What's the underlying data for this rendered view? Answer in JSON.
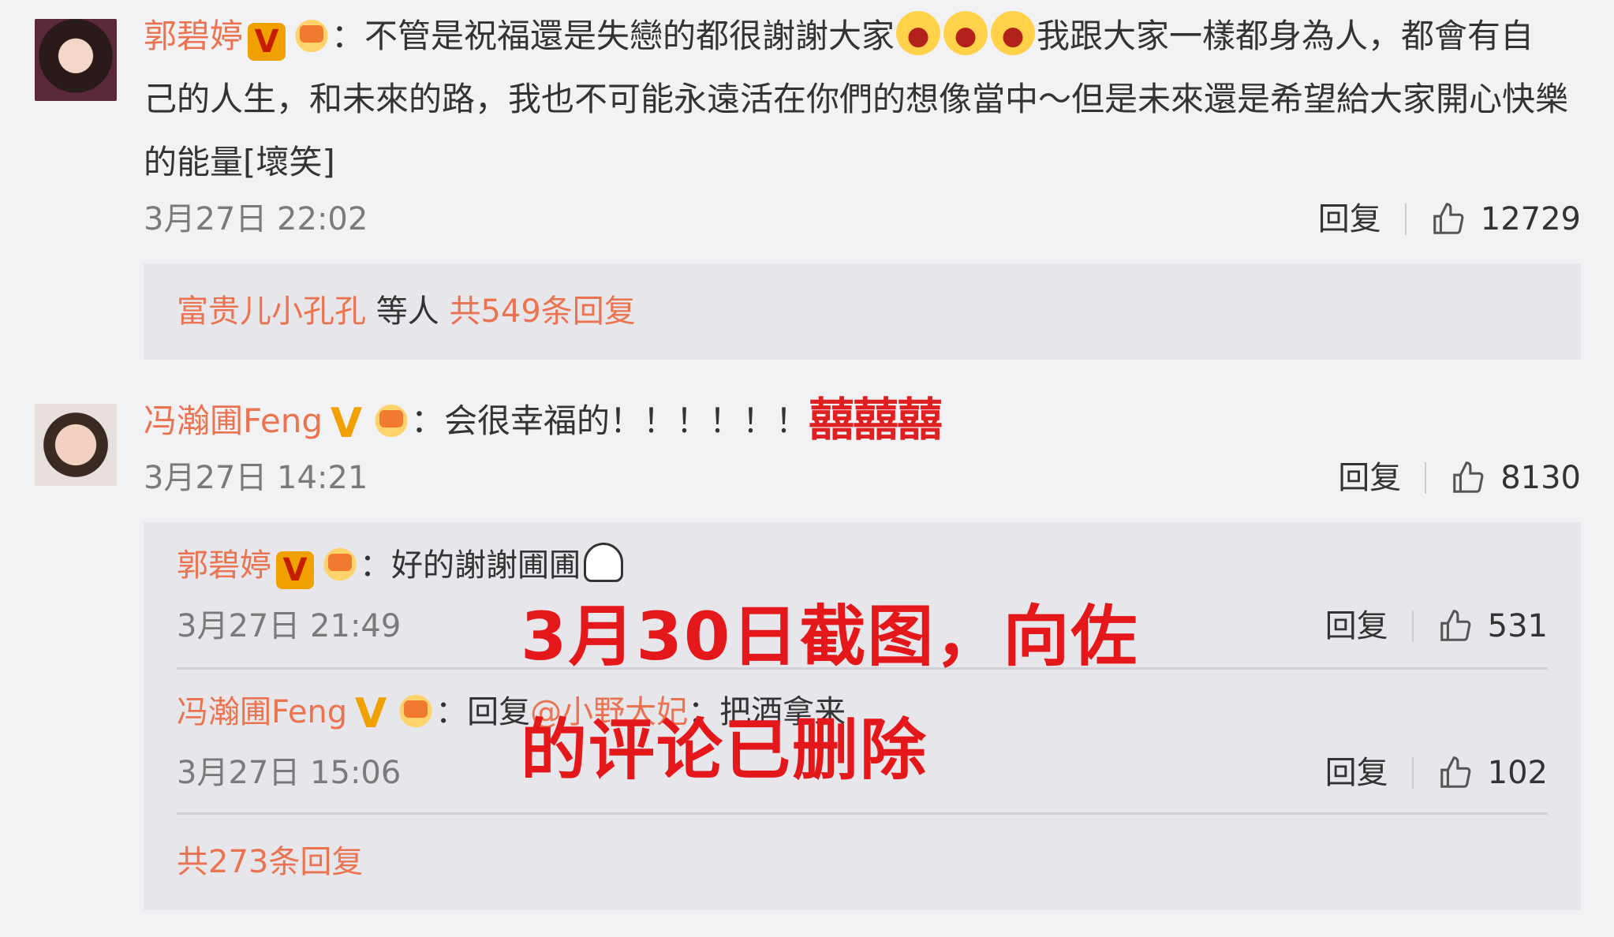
{
  "comments": [
    {
      "user": "郭碧婷",
      "badge": "V",
      "text_lines": [
        "：不管是祝福還是失戀的都很謝謝大家",
        "我跟大家一樣都身為人，都會有自",
        "己的人生，和未來的路，我也不可能永遠活在你們的想像當中～但是未來還是希望給大家開心快樂",
        "的能量[壞笑]"
      ],
      "emoji_name": "laugh-emoji",
      "time": "3月27日 22:02",
      "reply_label": "回复",
      "likes": "12729",
      "summary": {
        "user": "富贵儿小孔孔",
        "middle": " 等人 ",
        "count": "共549条回复"
      }
    },
    {
      "user": "冯瀚圃Feng",
      "badge": "V",
      "text": "：会很幸福的！！！！！！",
      "extra": "囍囍囍",
      "time": "3月27日 14:21",
      "reply_label": "回复",
      "likes": "8130",
      "replies": [
        {
          "user": "郭碧婷",
          "badge": "V",
          "text": "：好的謝謝圃圃",
          "time": "3月27日 21:49",
          "reply_label": "回复",
          "likes": "531"
        },
        {
          "user": "冯瀚圃Feng",
          "badge": "V",
          "text_prefix": "：回复",
          "mention": "@小野大妃",
          "text_suffix": "：把酒拿来",
          "time": "3月27日 15:06",
          "reply_label": "回复",
          "likes": "102"
        }
      ],
      "total_replies": "共273条回复"
    }
  ],
  "overlay": {
    "line1": "3月30日截图，向佐",
    "line2": "的评论已删除"
  },
  "colors": {
    "username": "#eb7350",
    "overlay": "#e4171a",
    "background": "#f2f2f5",
    "reply_box": "#e6e6eb"
  }
}
